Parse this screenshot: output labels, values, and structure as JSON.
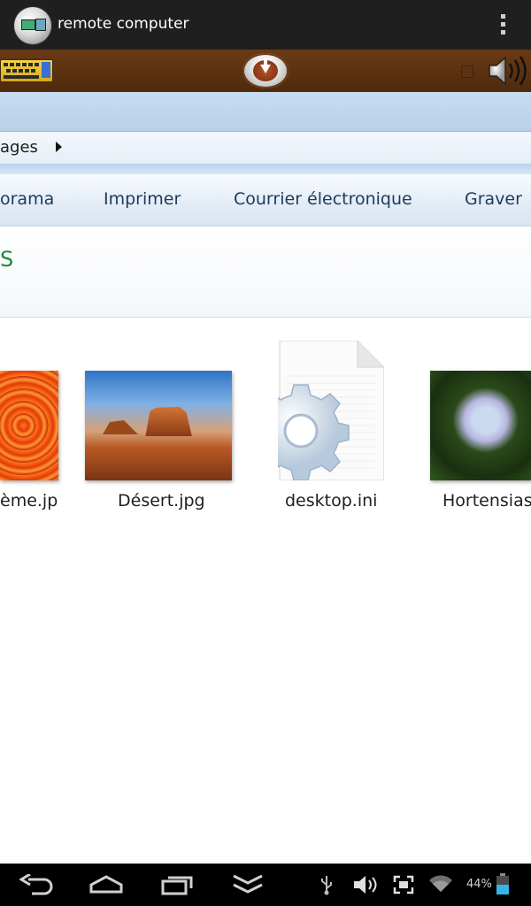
{
  "app_bar": {
    "title": "remote computer"
  },
  "explorer": {
    "breadcrumb": "ages",
    "commands": [
      "orama",
      "Imprimer",
      "Courrier électronique",
      "Graver"
    ],
    "library_title": "S",
    "files": [
      {
        "name": "ème.jp",
        "thumbnail": "chrysanthemum"
      },
      {
        "name": "Désert.jpg",
        "thumbnail": "desert"
      },
      {
        "name": "desktop.ini",
        "thumbnail": "settings-file-icon"
      },
      {
        "name": "Hortensias",
        "thumbnail": "hydrangea"
      }
    ]
  },
  "system_bar": {
    "battery": "44%",
    "icons": [
      "back-icon",
      "home-icon",
      "recent-apps-icon",
      "hide-keyboard-icon",
      "usb-icon",
      "volume-icon",
      "screenshot-icon",
      "wifi-icon",
      "battery-icon"
    ]
  },
  "colors": {
    "toolbar_brown": "#5a3110",
    "library_title_green": "#1a8a3a",
    "window_blue": "#b8d0ea"
  }
}
